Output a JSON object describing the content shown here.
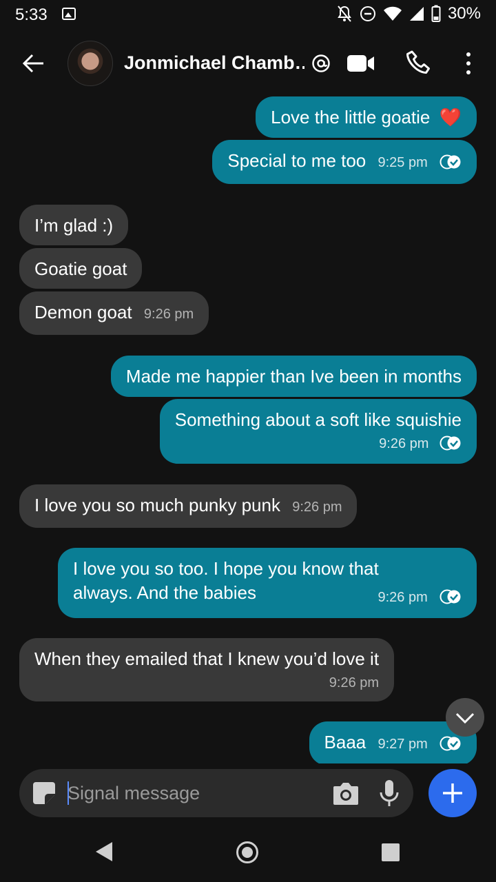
{
  "status_bar": {
    "time": "5:33",
    "battery": "30%"
  },
  "header": {
    "contact_name": "Jonmichael Chamb…"
  },
  "messages": [
    {
      "dir": "out",
      "text": "Love the little goatie",
      "emoji": "❤️",
      "time": ""
    },
    {
      "dir": "out",
      "text": "Special to me too",
      "time": "9:25 pm"
    },
    {
      "dir": "in",
      "text": "I’m glad :)",
      "time": ""
    },
    {
      "dir": "in",
      "text": "Goatie goat",
      "time": ""
    },
    {
      "dir": "in",
      "text": "Demon goat",
      "time": "9:26 pm"
    },
    {
      "dir": "out",
      "text": "Made me happier than Ive been in months",
      "time": ""
    },
    {
      "dir": "out",
      "text": "Something about a soft like squishie",
      "time": "9:26 pm"
    },
    {
      "dir": "in",
      "text": "I love you so much punky punk",
      "time": "9:26 pm"
    },
    {
      "dir": "out",
      "lines": [
        "I love you so too. I hope you know that",
        "always. And the babies"
      ],
      "time": "9:26 pm"
    },
    {
      "dir": "in",
      "text": "When they emailed that I knew you’d love it",
      "time": "9:26 pm"
    },
    {
      "dir": "out",
      "text": "Baaa",
      "time": "9:27 pm"
    }
  ],
  "composer": {
    "placeholder": "Signal message"
  },
  "colors": {
    "outgoing_bubble": "#0a7e95",
    "incoming_bubble": "#393939",
    "accent": "#2c6bed",
    "background": "#121212"
  }
}
